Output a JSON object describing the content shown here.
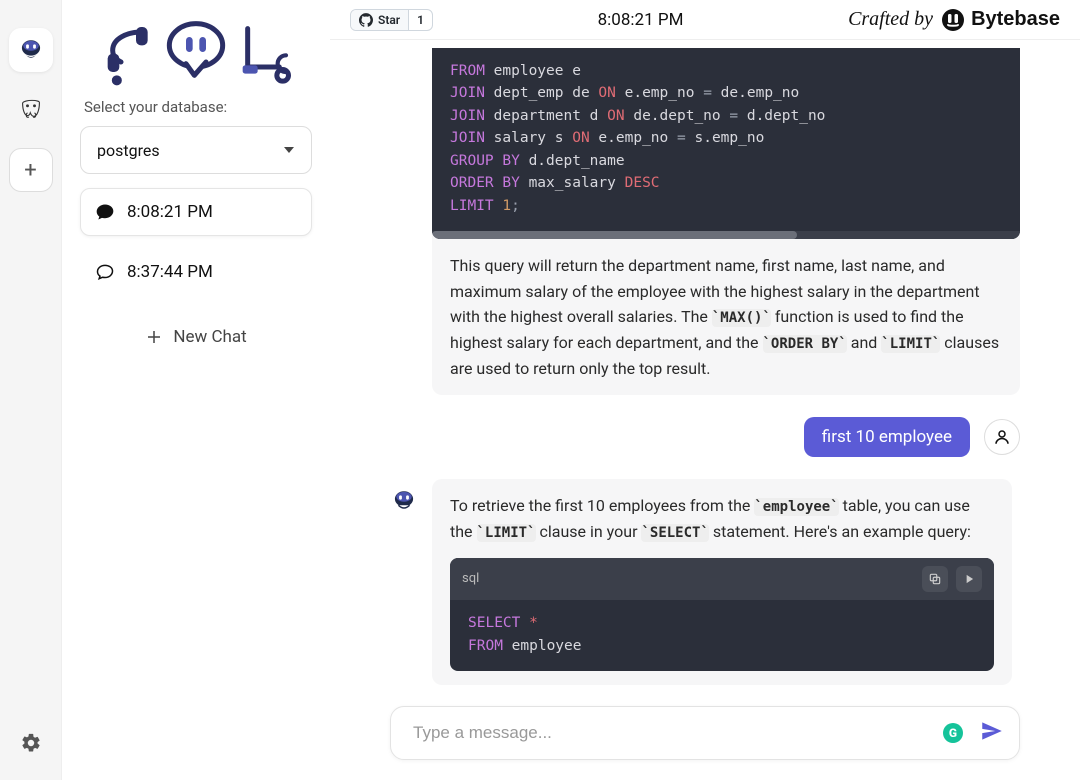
{
  "topbar": {
    "gh_star_label": "Star",
    "gh_star_count": "1",
    "title_time": "8:08:21 PM",
    "crafted_by": "Crafted by",
    "brand_name": "Bytebase"
  },
  "sidebar": {
    "select_label": "Select your database:",
    "db_selected": "postgres",
    "chats": [
      {
        "label": "8:08:21 PM",
        "active": true,
        "filled": true
      },
      {
        "label": "8:37:44 PM",
        "active": false,
        "filled": false
      }
    ],
    "new_chat_label": "New Chat"
  },
  "conversation": {
    "msg1_code": {
      "lines": [
        [
          [
            "kw",
            "FROM"
          ],
          [
            "id",
            " employee e"
          ]
        ],
        [
          [
            "kw",
            "JOIN"
          ],
          [
            "id",
            " dept_emp de "
          ],
          [
            "kw2",
            "ON"
          ],
          [
            "id",
            " e.emp_no "
          ],
          [
            "punc",
            "="
          ],
          [
            "id",
            " de.emp_no"
          ]
        ],
        [
          [
            "kw",
            "JOIN"
          ],
          [
            "id",
            " department d "
          ],
          [
            "kw2",
            "ON"
          ],
          [
            "id",
            " de.dept_no "
          ],
          [
            "punc",
            "="
          ],
          [
            "id",
            " d.dept_no"
          ]
        ],
        [
          [
            "kw",
            "JOIN"
          ],
          [
            "id",
            " salary s "
          ],
          [
            "kw2",
            "ON"
          ],
          [
            "id",
            " e.emp_no "
          ],
          [
            "punc",
            "="
          ],
          [
            "id",
            " s.emp_no"
          ]
        ],
        [
          [
            "kw",
            "GROUP BY"
          ],
          [
            "id",
            " d.dept_name"
          ]
        ],
        [
          [
            "kw",
            "ORDER BY"
          ],
          [
            "id",
            " max_salary "
          ],
          [
            "kw2",
            "DESC"
          ]
        ],
        [
          [
            "kw",
            "LIMIT"
          ],
          [
            "id",
            " "
          ],
          [
            "num",
            "1"
          ],
          [
            "punc",
            ";"
          ]
        ]
      ]
    },
    "msg1_text_parts": [
      "This query will return the department name, first name, last name, and maximum salary of the employee with the highest salary in the department with the highest overall salaries. The ",
      "`MAX()`",
      " function is used to find the highest salary for each department, and the ",
      "`ORDER BY`",
      " and ",
      "`LIMIT`",
      " clauses are used to return only the top result."
    ],
    "user_msg": "first 10 employee",
    "msg2_text_parts": [
      "To retrieve the first 10 employees from the ",
      "`employee`",
      " table, you can use the ",
      "`LIMIT`",
      " clause in your ",
      "`SELECT`",
      " statement. Here's an example query:"
    ],
    "msg2_code": {
      "lang": "sql",
      "lines": [
        [
          [
            "kw",
            "SELECT"
          ],
          [
            "id",
            " "
          ],
          [
            "star",
            "*"
          ]
        ],
        [
          [
            "kw",
            "FROM"
          ],
          [
            "id",
            " employee"
          ]
        ]
      ]
    }
  },
  "composer": {
    "placeholder": "Type a message..."
  }
}
